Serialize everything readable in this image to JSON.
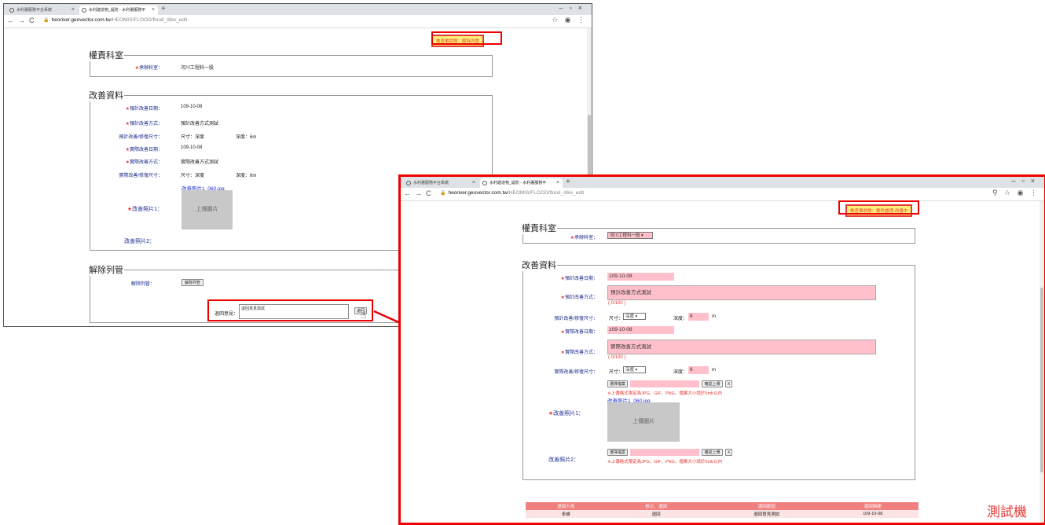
{
  "window_a": {
    "tabs": [
      "水利署服務平台系統",
      "水利建造物_堤防 - 水利署服務平"
    ],
    "url_host": "heoriver.geovector.com.tw",
    "url_path": "/HEOMIS/FLOOD/flood_dike_edit",
    "status": "檢查單狀態：解除列管",
    "section_office": {
      "legend": "權責科室",
      "label": "承辦科室：",
      "value": "河川工程科一股"
    },
    "section_improve": {
      "legend": "改善資料",
      "plan_date_label": "預計改善日期：",
      "plan_date": "109-10-08",
      "plan_method_label": "預計改善方式：",
      "plan_method": "預計改善方式測試",
      "plan_size_label": "預計改善/修復尺寸：",
      "size_prefix": "尺寸：",
      "size_value": "深度",
      "depth_prefix": "深度：",
      "depth_value": "6m",
      "real_date_label": "實際改善日期：",
      "real_date": "109-10-08",
      "real_method_label": "實際改善方式：",
      "real_method": "實際改善方式測試",
      "real_size_label": "實際改善/修復尺寸：",
      "photo_link": "改善照片1_060.jpg",
      "photo_placeholder": "上傳圖片",
      "photo1_label": "改善照片1：",
      "photo2_label": "改善照片2："
    },
    "section_release": {
      "legend": "解除列管",
      "label": "解除列管：",
      "button": "解除列管",
      "return_label": "退回意見：",
      "return_text": "退回意見測試",
      "return_button": "退回"
    }
  },
  "window_b": {
    "tabs": [
      "水利署服務平台系統",
      "水利建造物_堤防 - 水利署服務平"
    ],
    "url_host": "heoriver.geovector.com.tw",
    "url_path": "/HEOMIS/FLOOD/flood_dike_edit",
    "status": "檢查單狀態：案件處理-改善中",
    "section_office": {
      "legend": "權責科室",
      "label": "承辦科室：",
      "value": "河川工程科一股"
    },
    "section_improve": {
      "legend": "改善資料",
      "plan_date_label": "預計改善日期：",
      "plan_date": "109-10-08",
      "plan_method_label": "預計改善方式：",
      "plan_method": "預計改善方式測試",
      "counter": "( 0/100 )",
      "plan_size_label": "預計改善/修復尺寸：",
      "size_prefix": "尺寸：",
      "size_value": "深度",
      "depth_prefix": "深度：",
      "depth_value": "6",
      "unit": "m",
      "real_date_label": "實際改善日期：",
      "real_date": "109-10-08",
      "real_method_label": "實際改善方式：",
      "real_method": "實際改善方式測試",
      "real_size_label": "實際改善/修復尺寸：",
      "choose_file": "選擇檔案",
      "confirm_upload": "確認上傳",
      "clear": "X",
      "upload_note": "※上傳格式限定為JPG、GIF、PNG，檔案大小請於5mb以內",
      "photo_link": "改善照片1_060.jpg",
      "photo_placeholder": "上傳圖片",
      "photo1_label": "改善照片1：",
      "photo2_label": "改善照片2："
    },
    "history": {
      "headers": [
        "退回人員",
        "核示、退回",
        "退回原因",
        "退回時間"
      ],
      "rows": [
        [
          "多維",
          "退回",
          "退回意見測試",
          "109-10-08"
        ]
      ]
    }
  },
  "watermark": "測試機",
  "colors": {
    "highlight": "#e00000",
    "status_bg": "#fff176",
    "field_pink": "#ffc0cb",
    "label_blue": "#1a2b8c",
    "table_header": "#f08080"
  }
}
